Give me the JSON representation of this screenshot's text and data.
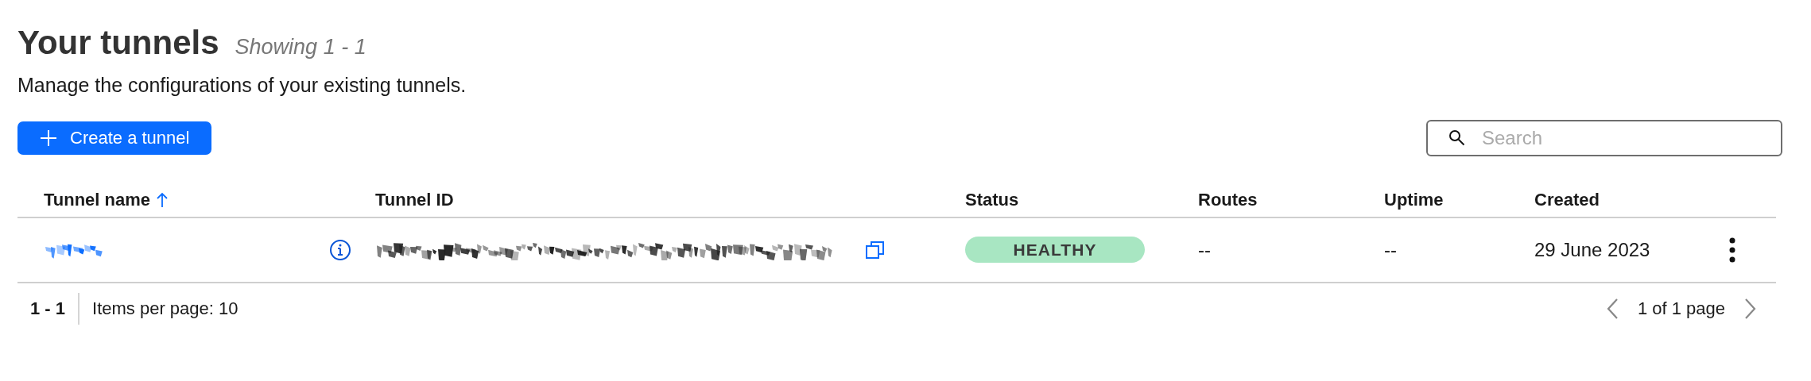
{
  "header": {
    "title": "Your tunnels",
    "showing": "Showing 1 - 1",
    "description": "Manage the configurations of your existing tunnels."
  },
  "create_button": {
    "label": "Create a tunnel"
  },
  "search": {
    "placeholder": "Search"
  },
  "table": {
    "columns": [
      {
        "label": "Tunnel name",
        "sorted": true
      },
      {
        "label": "Tunnel ID",
        "sorted": false
      },
      {
        "label": "Status",
        "sorted": false
      },
      {
        "label": "Routes",
        "sorted": false
      },
      {
        "label": "Uptime",
        "sorted": false
      },
      {
        "label": "Created",
        "sorted": false
      }
    ],
    "rows": [
      {
        "status": {
          "label": "HEALTHY",
          "kind": "healthy"
        },
        "routes": "--",
        "uptime": "--",
        "created": "29 June 2023"
      }
    ]
  },
  "pagination": {
    "range": "1 - 1",
    "items_per_page": "Items per page: 10",
    "page_label": "1 of 1 page"
  }
}
